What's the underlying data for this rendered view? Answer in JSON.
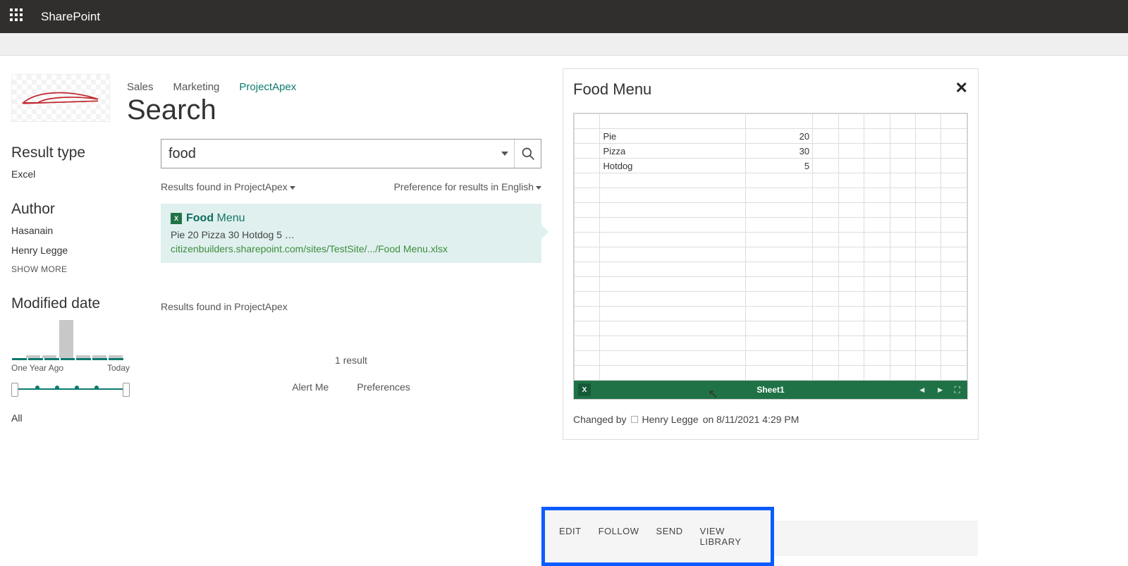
{
  "header": {
    "brand": "SharePoint"
  },
  "nav": {
    "items": [
      "Sales",
      "Marketing",
      "ProjectApex"
    ],
    "active_index": 2
  },
  "page": {
    "title": "Search"
  },
  "refiners": {
    "result_type": {
      "label": "Result type",
      "items": [
        "Excel"
      ]
    },
    "author": {
      "label": "Author",
      "items": [
        "Hasanain",
        "Henry Legge"
      ],
      "show_more": "SHOW MORE"
    },
    "modified": {
      "label": "Modified date",
      "range_labels": [
        "One Year Ago",
        "Today"
      ],
      "all_label": "All"
    }
  },
  "search": {
    "query": "food",
    "scope_text_prefix": "Results found in ",
    "scope_value": "ProjectApex",
    "pref_text_prefix": "Preference for results in ",
    "pref_value": "English",
    "count_text": "1 result",
    "alert_me": "Alert Me",
    "preferences": "Preferences"
  },
  "result": {
    "title_highlight": "Food",
    "title_rest": " Menu",
    "snippet": "Pie 20 Pizza 30 Hotdog 5 …",
    "url": "citizenbuilders.sharepoint.com/sites/TestSite/.../Food Menu.xlsx"
  },
  "preview": {
    "title": "Food Menu",
    "rows": [
      {
        "a": "Pie",
        "b": "20"
      },
      {
        "a": "Pizza",
        "b": "30"
      },
      {
        "a": "Hotdog",
        "b": "5"
      }
    ],
    "sheet_name": "Sheet1",
    "changed_by_prefix": "Changed by",
    "changed_by_name": "Henry Legge",
    "changed_by_suffix": "on 8/11/2021 4:29 PM"
  },
  "actions": {
    "edit": "EDIT",
    "follow": "FOLLOW",
    "send": "SEND",
    "view_library": "VIEW LIBRARY"
  }
}
